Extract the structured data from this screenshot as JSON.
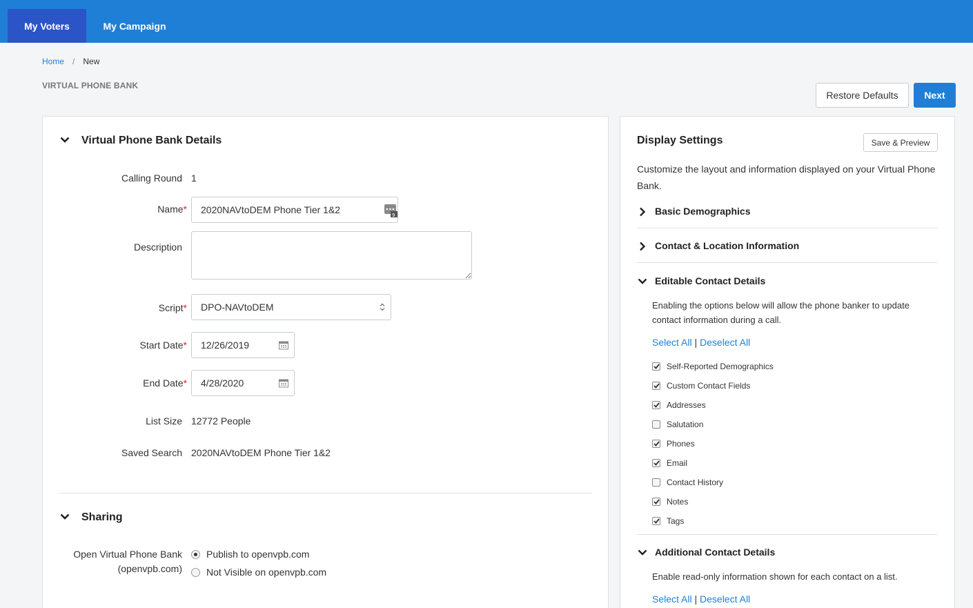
{
  "nav": {
    "tabs": [
      {
        "label": "My Voters",
        "active": true
      },
      {
        "label": "My Campaign",
        "active": false
      }
    ]
  },
  "breadcrumb": {
    "home": "Home",
    "separator": "/",
    "current": "New"
  },
  "page": {
    "title": "VIRTUAL PHONE BANK"
  },
  "actions": {
    "restore": "Restore Defaults",
    "next": "Next"
  },
  "details": {
    "title": "Virtual Phone Bank Details",
    "calling_round_label": "Calling Round",
    "calling_round": "1",
    "name_label": "Name",
    "name_value": "2020NAVtoDEM Phone Tier 1&2",
    "description_label": "Description",
    "description_value": "",
    "script_label": "Script",
    "script_value": "DPO-NAVtoDEM",
    "start_label": "Start Date",
    "start_value": "12/26/2019",
    "end_label": "End Date",
    "end_value": "4/28/2020",
    "list_size_label": "List Size",
    "list_size": "12772 People",
    "saved_search_label": "Saved Search",
    "saved_search": "2020NAVtoDEM Phone Tier 1&2",
    "required_mark": "*"
  },
  "sharing": {
    "title": "Sharing",
    "label_line1": "Open Virtual Phone Bank",
    "label_line2": "(openvpb.com)",
    "options": [
      {
        "label": "Publish to openvpb.com",
        "selected": true
      },
      {
        "label": "Not Visible on openvpb.com",
        "selected": false
      }
    ]
  },
  "display": {
    "title": "Display Settings",
    "save_preview": "Save & Preview",
    "description": "Customize the layout and information displayed on your Virtual Phone Bank.",
    "sections": {
      "basic": "Basic Demographics",
      "contact_location": "Contact & Location Information",
      "editable": "Editable Contact Details",
      "additional": "Additional Contact Details"
    },
    "editable_desc": "Enabling the options below will allow the phone banker to update contact information during a call.",
    "additional_desc": "Enable read-only information shown for each contact on a list.",
    "select_all": "Select All",
    "pipe": "|",
    "deselect_all": "Deselect All",
    "editable_items": [
      {
        "label": "Self-Reported Demographics",
        "checked": true
      },
      {
        "label": "Custom Contact Fields",
        "checked": true
      },
      {
        "label": "Addresses",
        "checked": true
      },
      {
        "label": "Salutation",
        "checked": false
      },
      {
        "label": "Phones",
        "checked": true
      },
      {
        "label": "Email",
        "checked": true
      },
      {
        "label": "Contact History",
        "checked": false
      },
      {
        "label": "Notes",
        "checked": true
      },
      {
        "label": "Tags",
        "checked": true
      }
    ]
  },
  "colors": {
    "nav": "#1f7fd6",
    "nav_active": "#2b55c6",
    "link": "#1f7fd6",
    "required": "#d9262b"
  }
}
